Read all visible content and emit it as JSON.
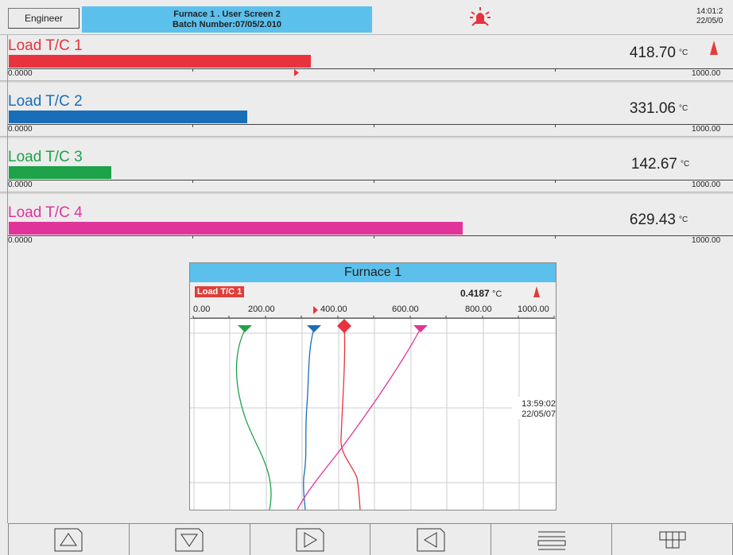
{
  "header": {
    "user_button": "Engineer",
    "title_line1": "Furnace 1 . User Screen 2",
    "title_line2": "Batch Number:07/05/2.010",
    "time": "14:01:2",
    "date": "22/05/0",
    "alarm_icon": "alarm-bell-icon"
  },
  "channels": [
    {
      "name": "Load T/C 1",
      "value": "418.70",
      "unit": "°C",
      "color": "#e8333f",
      "fill_fraction": 0.4187,
      "scale_lo": "0.0000",
      "scale_hi": "1000.00",
      "alarm": true,
      "marker_fraction": 0.4
    },
    {
      "name": "Load T/C 2",
      "value": "331.06",
      "unit": "°C",
      "color": "#1a6eb8",
      "fill_fraction": 0.33106,
      "scale_lo": "0.0000",
      "scale_hi": "1000.00",
      "alarm": false
    },
    {
      "name": "Load T/C 3",
      "value": "142.67",
      "unit": "°C",
      "color": "#1ea24a",
      "fill_fraction": 0.14267,
      "scale_lo": "0.0000",
      "scale_hi": "1000.00",
      "alarm": false
    },
    {
      "name": "Load T/C 4",
      "value": "629.43",
      "unit": "°C",
      "color": "#e0349a",
      "fill_fraction": 0.62943,
      "scale_lo": "0.0000",
      "scale_hi": "1000.00",
      "alarm": false
    }
  ],
  "trend": {
    "title": "Furnace 1",
    "channel_name": "Load T/C 1",
    "channel_value": "0.4187",
    "channel_unit": "°C",
    "scale_labels": [
      "0.00",
      "200.00",
      "400.00",
      "600.00",
      "800.00",
      "1000.00"
    ],
    "timestamp_time": "13:59:02",
    "timestamp_date": "22/05/07"
  },
  "softkeys": [
    {
      "name": "up-arrow-icon"
    },
    {
      "name": "down-arrow-icon"
    },
    {
      "name": "right-arrow-icon"
    },
    {
      "name": "left-arrow-icon"
    },
    {
      "name": "menu-icon"
    },
    {
      "name": "grid-icon"
    }
  ]
}
